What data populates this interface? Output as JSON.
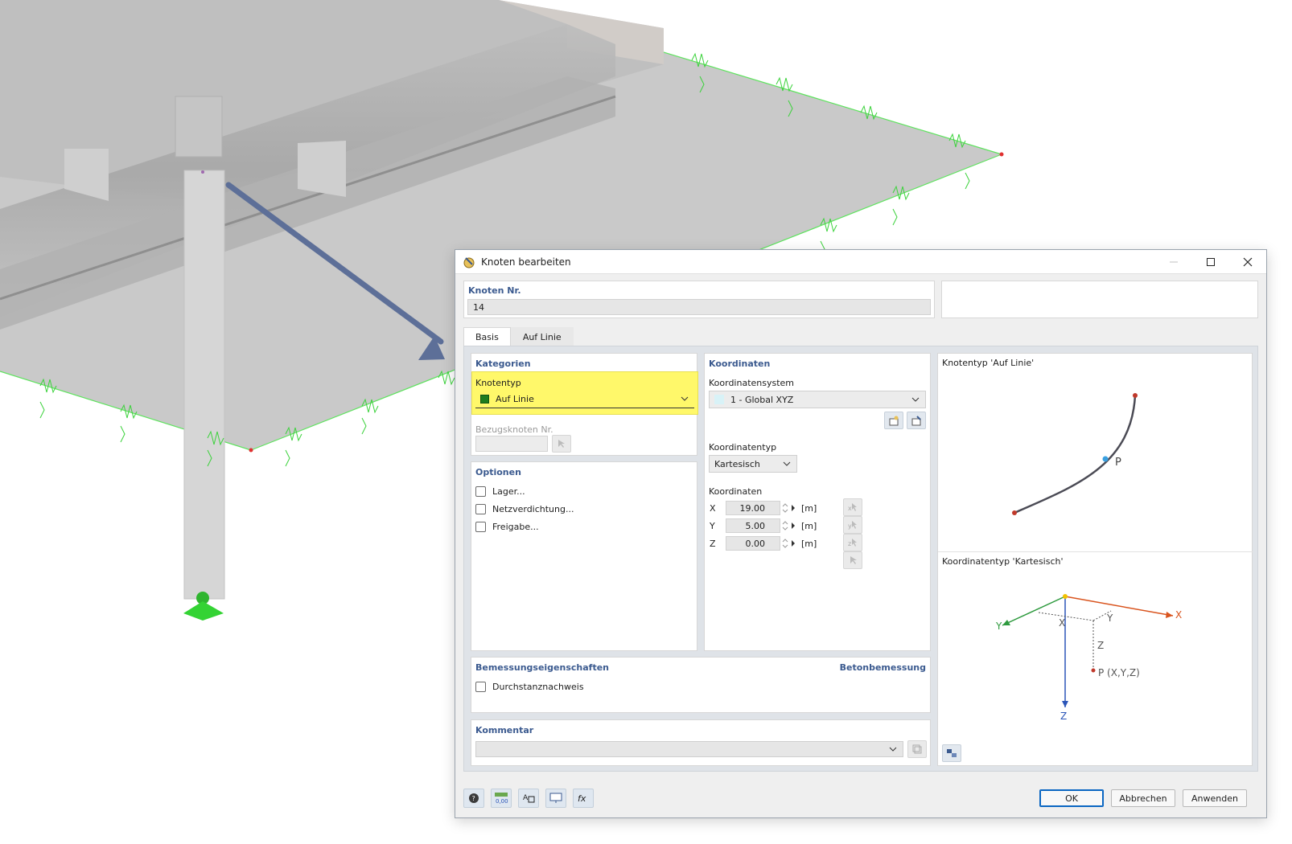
{
  "dialog": {
    "title": "Knoten bearbeiten",
    "node_number_label": "Knoten Nr.",
    "node_number_value": "14",
    "tabs": [
      {
        "label": "Basis",
        "active": true
      },
      {
        "label": "Auf Linie",
        "active": false
      }
    ],
    "categories": {
      "title": "Kategorien",
      "node_type_label": "Knotentyp",
      "node_type_value": "Auf Linie",
      "node_type_color": "#1e7e1e",
      "reference_node_label": "Bezugsknoten Nr.",
      "reference_node_value": ""
    },
    "options": {
      "title": "Optionen",
      "items": [
        {
          "label": "Lager...",
          "checked": false
        },
        {
          "label": "Netzverdichtung...",
          "checked": false
        },
        {
          "label": "Freigabe...",
          "checked": false
        }
      ]
    },
    "coordinates": {
      "title": "Koordinaten",
      "system_label": "Koordinatensystem",
      "system_value": "1 - Global XYZ",
      "type_label": "Koordinatentyp",
      "type_value": "Kartesisch",
      "values_label": "Koordinaten",
      "rows": [
        {
          "axis": "X",
          "value": "19.00",
          "unit": "[m]"
        },
        {
          "axis": "Y",
          "value": "5.00",
          "unit": "[m]"
        },
        {
          "axis": "Z",
          "value": "0.00",
          "unit": "[m]"
        }
      ]
    },
    "preview": {
      "node_type_title": "Knotentyp 'Auf Linie'",
      "point_label": "P",
      "coord_type_title": "Koordinatentyp 'Kartesisch'",
      "axis_labels": {
        "x": "X",
        "y": "Y",
        "z": "Z"
      },
      "point_coord_label": "P (X,Y,Z)"
    },
    "design": {
      "title": "Bemessungseigenschaften",
      "right_title": "Betonbemessung",
      "punching_label": "Durchstanznachweis"
    },
    "comment": {
      "title": "Kommentar",
      "value": ""
    },
    "buttons": {
      "ok": "OK",
      "cancel": "Abbrechen",
      "apply": "Anwenden"
    }
  }
}
